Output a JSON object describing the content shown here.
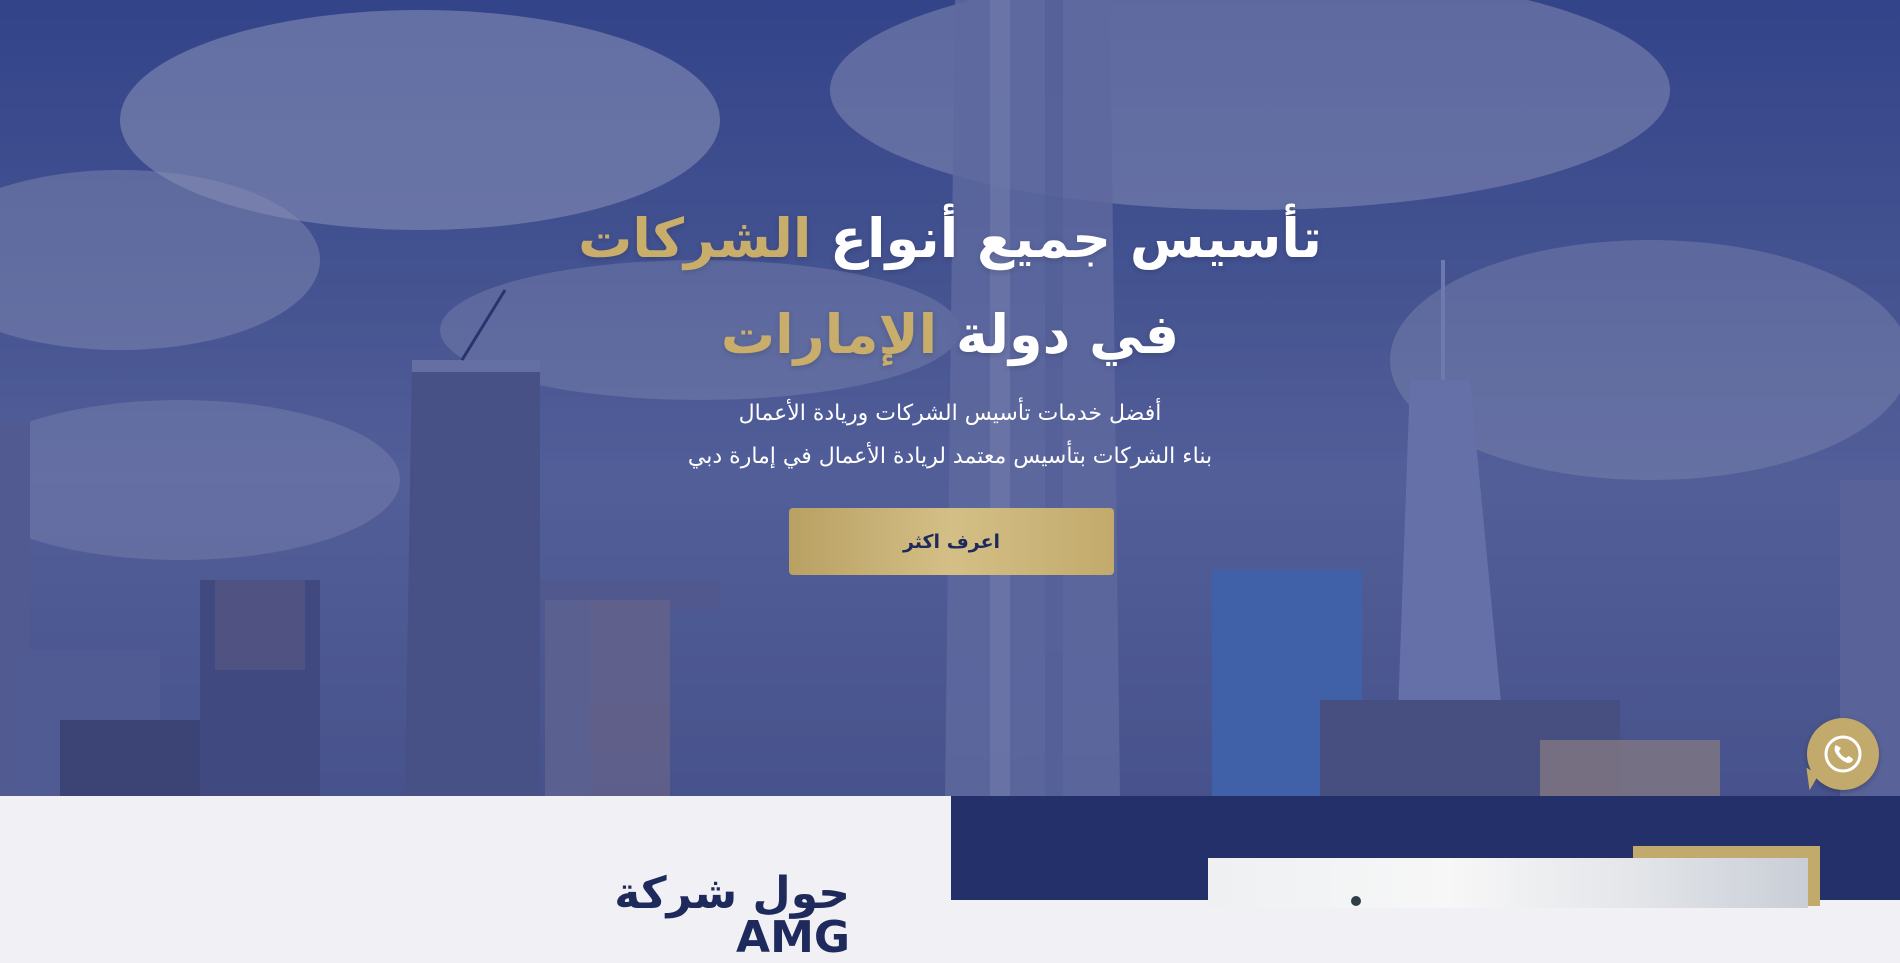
{
  "hero": {
    "headline_line1_white": "تأسيس جميع أنواع",
    "headline_line1_gold": "الشركات",
    "headline_line2_white": "في دولة",
    "headline_line2_gold": "الإمارات",
    "subtitle_line1": "أفضل خدمات تأسيس الشركات وريادة الأعمال",
    "subtitle_line2": "بناء الشركات بتأسيس معتمد لريادة الأعمال في إمارة دبي",
    "cta_label": "اعرف اكثر",
    "background_image": "dubai-skyline-with-burj-khalifa"
  },
  "about": {
    "title": "حول شركة AMG"
  },
  "floating": {
    "whatsapp_icon": "whatsapp-phone-icon"
  },
  "colors": {
    "navy": "#243069",
    "gold": "#c2aa6c",
    "gold_text": "#c8ad6b",
    "light_bg": "#f1f0f5"
  }
}
